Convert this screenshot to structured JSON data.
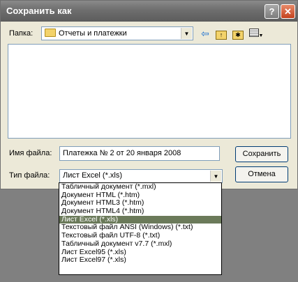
{
  "window": {
    "title": "Сохранить как",
    "help_label": "?",
    "close_label": "✕"
  },
  "folder": {
    "label": "Папка:",
    "value": "Отчеты и платежки"
  },
  "toolbar": {
    "back_icon": "back-arrow-icon",
    "up_icon": "folder-up-icon",
    "new_folder_icon": "new-folder-icon",
    "view_icon": "view-menu-icon"
  },
  "filename": {
    "label": "Имя файла:",
    "value": "Платежка № 2 от 20 января 2008"
  },
  "filetype": {
    "label": "Тип файла:",
    "value": "Лист Excel (*.xls)"
  },
  "buttons": {
    "save": "Сохранить",
    "cancel": "Отмена"
  },
  "dropdown": {
    "options": [
      "Табличный документ (*.mxl)",
      "Документ HTML (*.htm)",
      "Документ HTML3 (*.htm)",
      "Документ HTML4 (*.htm)",
      "Лист Excel (*.xls)",
      "Текстовый файл ANSI (Windows) (*.txt)",
      "Текстовый файл UTF-8 (*.txt)",
      "Табличный документ v7.7 (*.mxl)",
      "Лист Excel95 (*.xls)",
      "Лист Excel97 (*.xls)"
    ],
    "selected_index": 4
  },
  "colors": {
    "selection": "#6b7a5a",
    "backdrop": "#808080"
  }
}
